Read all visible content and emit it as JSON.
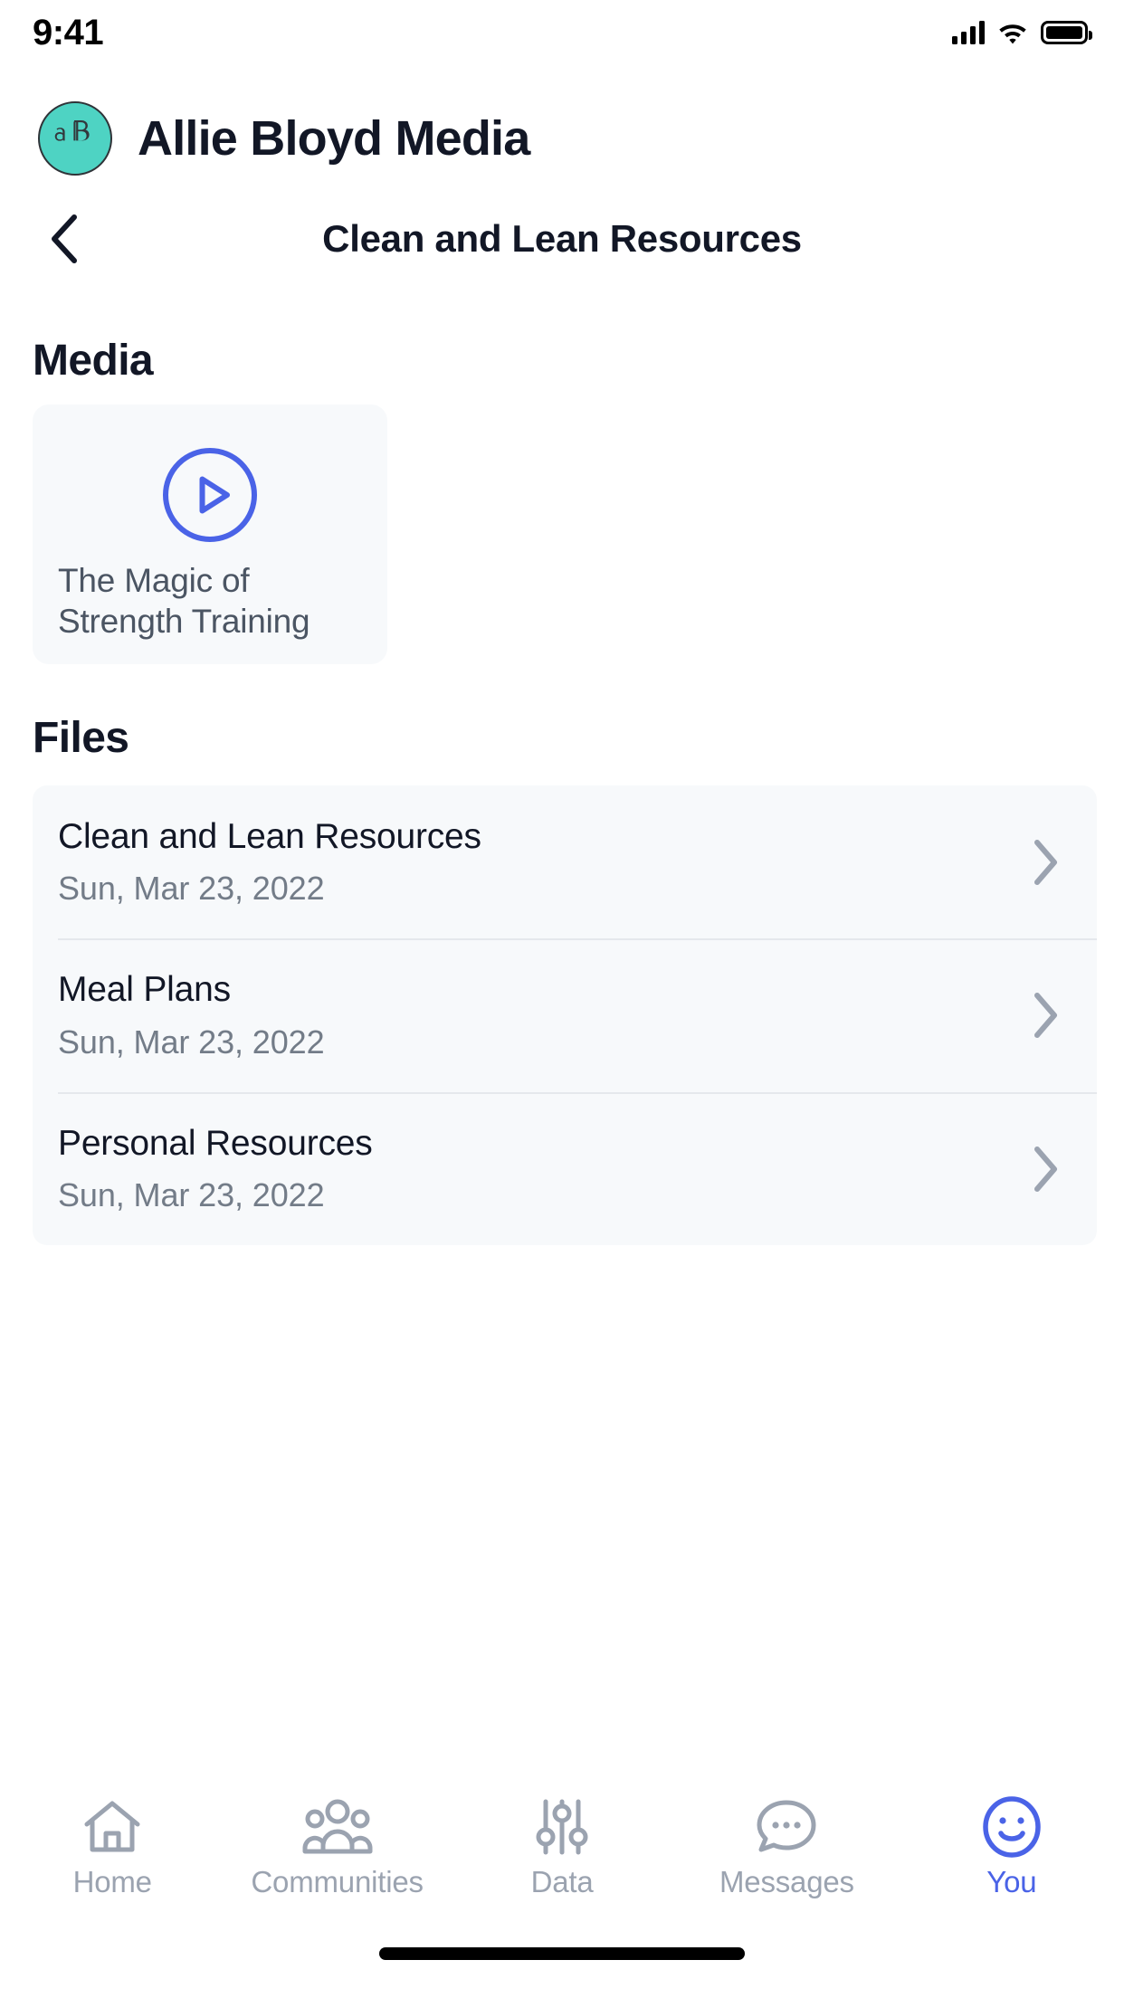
{
  "status_bar": {
    "time": "9:41",
    "signal_icon": "signal-bars-icon",
    "wifi_icon": "wifi-icon",
    "battery_icon": "battery-full-icon"
  },
  "brand": {
    "name": "Allie Bloyd Media",
    "logo_monogram": "aB",
    "logo_bg_color": "#4ED3C3",
    "logo_fg_color": "#33383C"
  },
  "navbar": {
    "back_icon": "chevron-left-icon",
    "title": "Clean and Lean Resources"
  },
  "media_section": {
    "heading": "Media",
    "items": [
      {
        "title": "The Magic of Strength Training",
        "play_icon": "play-circle-icon",
        "accent_color": "#4A63E7"
      }
    ]
  },
  "files_section": {
    "heading": "Files",
    "chevron_icon": "chevron-right-icon",
    "rows": [
      {
        "name": "Clean and Lean Resources",
        "date": "Sun, Mar 23, 2022"
      },
      {
        "name": "Meal Plans",
        "date": "Sun, Mar 23, 2022"
      },
      {
        "name": "Personal Resources",
        "date": "Sun, Mar 23, 2022"
      }
    ]
  },
  "tabbar": {
    "active_color": "#4A63E7",
    "inactive_color": "#9BA3B0",
    "tabs": [
      {
        "label": "Home",
        "icon": "home-icon",
        "active": false
      },
      {
        "label": "Communities",
        "icon": "people-group-icon",
        "active": false
      },
      {
        "label": "Data",
        "icon": "sliders-icon",
        "active": false
      },
      {
        "label": "Messages",
        "icon": "chat-bubble-icon",
        "active": false
      },
      {
        "label": "You",
        "icon": "smiley-face-icon",
        "active": true
      }
    ]
  },
  "home_indicator": {
    "present": true
  }
}
